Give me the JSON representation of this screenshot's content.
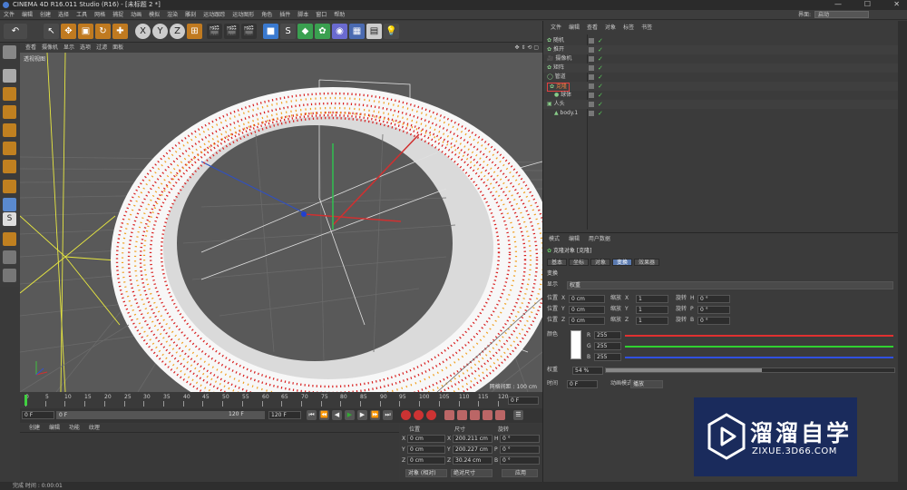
{
  "window": {
    "title": "CINEMA 4D R16.011 Studio (R16) - [未标题 2 *]"
  },
  "menubar": [
    "文件",
    "编辑",
    "创建",
    "选择",
    "工具",
    "网格",
    "捕捉",
    "动画",
    "模拟",
    "渲染",
    "雕刻",
    "运动跟踪",
    "运动图形",
    "角色",
    "插件",
    "脚本",
    "窗口",
    "帮助"
  ],
  "layout": {
    "label": "界面:",
    "value": "启动"
  },
  "toolbar": {
    "x_label": "X",
    "y_label": "Y",
    "z_label": "Z"
  },
  "viewport": {
    "menu": [
      "查看",
      "摄像机",
      "显示",
      "选项",
      "过滤",
      "面板"
    ],
    "label": "透视视图",
    "grid_info": "网格间距 : 100 cm"
  },
  "timeline": {
    "ticks": [
      "0",
      "5",
      "10",
      "15",
      "20",
      "25",
      "30",
      "35",
      "40",
      "45",
      "50",
      "55",
      "60",
      "65",
      "70",
      "75",
      "80",
      "85",
      "90",
      "95",
      "100",
      "105",
      "110",
      "115",
      "120"
    ],
    "current": "0 F"
  },
  "controls": {
    "start": "0 F",
    "min": "0 F",
    "max": "120 F",
    "end": "120 F"
  },
  "materials": {
    "menu": [
      "创建",
      "编辑",
      "功能",
      "纹理"
    ]
  },
  "coords": {
    "headers": {
      "pos": "位置",
      "size": "尺寸",
      "rot": "旋转"
    },
    "rows": [
      {
        "axis": "X",
        "pos": "0 cm",
        "saxis": "X",
        "size": "200.211 cm",
        "raxis": "H",
        "rot": "0 °"
      },
      {
        "axis": "Y",
        "pos": "0 cm",
        "saxis": "Y",
        "size": "200.227 cm",
        "raxis": "P",
        "rot": "0 °"
      },
      {
        "axis": "Z",
        "pos": "0 cm",
        "saxis": "Z",
        "size": "30.24 cm",
        "raxis": "B",
        "rot": "0 °"
      }
    ],
    "mode": "对象 (相对)",
    "size_mode": "绝对尺寸",
    "apply": "应用"
  },
  "objects": {
    "menu": [
      "文件",
      "编辑",
      "查看",
      "对象",
      "标签",
      "书签"
    ],
    "items": [
      {
        "name": "随机",
        "indent": 0,
        "selected": false
      },
      {
        "name": "推开",
        "indent": 0,
        "selected": false
      },
      {
        "name": "摄像机",
        "indent": 0,
        "selected": false
      },
      {
        "name": "矩阵",
        "indent": 0,
        "selected": false
      },
      {
        "name": "管道",
        "indent": 0,
        "selected": false
      },
      {
        "name": "克隆",
        "indent": 0,
        "selected": true
      },
      {
        "name": "球体",
        "indent": 1,
        "selected": false
      },
      {
        "name": "人头",
        "indent": 0,
        "selected": false
      },
      {
        "name": "body.1",
        "indent": 1,
        "selected": false
      }
    ]
  },
  "attributes": {
    "menu": [
      "模式",
      "编辑",
      "用户数据"
    ],
    "object_title": "克隆对象 [克隆]",
    "tabs": [
      "基本",
      "坐标",
      "对象",
      "变换",
      "效果器"
    ],
    "active_tab": 3,
    "section": "变换",
    "display_label": "显示",
    "display_value": "权重",
    "pos_label": "位置",
    "scale_label": "缩放",
    "rot_label": "旋转",
    "rows": [
      {
        "pa": "X",
        "pv": "0 cm",
        "sa": "X",
        "sv": "1",
        "ra": "H",
        "rv": "0 °"
      },
      {
        "pa": "Y",
        "pv": "0 cm",
        "sa": "Y",
        "sv": "1",
        "ra": "P",
        "rv": "0 °"
      },
      {
        "pa": "Z",
        "pv": "0 cm",
        "sa": "Z",
        "sv": "1",
        "ra": "B",
        "rv": "0 °"
      }
    ],
    "color_label": "颜色",
    "rgb": [
      {
        "c": "R",
        "v": "255"
      },
      {
        "c": "G",
        "v": "255"
      },
      {
        "c": "B",
        "v": "255"
      }
    ],
    "weight_label": "权重",
    "weight_value": "54 %",
    "weight_fraction": 0.54,
    "time_label": "时间",
    "time_value": "0 F",
    "anim_label": "动画模式",
    "anim_value": "播放"
  },
  "status": {
    "text": "完成 时间 : 0:00:01"
  },
  "watermark": {
    "title": "溜溜自学",
    "url": "ZIXUE.3D66.COM"
  },
  "colors": {
    "accent": "#5a7ab0",
    "selected_outline": "#e04040",
    "watermark_bg": "#182a5f"
  }
}
